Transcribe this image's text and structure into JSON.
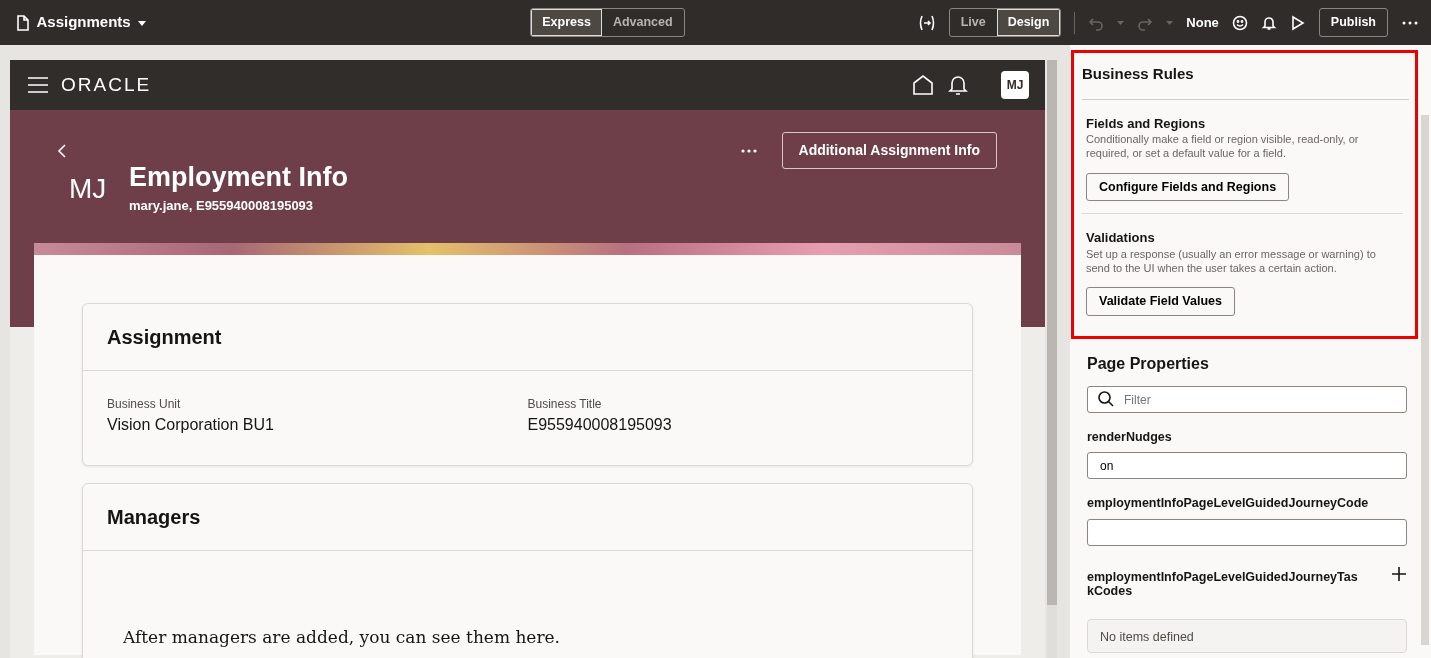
{
  "toolbar": {
    "page_title": "Assignments",
    "mode_tabs": [
      {
        "label": "Express",
        "selected": true
      },
      {
        "label": "Advanced",
        "selected": false
      }
    ],
    "view_tabs": [
      {
        "label": "Live",
        "selected": false
      },
      {
        "label": "Design",
        "selected": true
      }
    ],
    "undo_disabled": true,
    "redo_disabled": true,
    "audience": "None",
    "publish_button": "Publish"
  },
  "preview": {
    "app_header": {
      "brand": "ORACLE",
      "avatar": "MJ"
    },
    "page_header": {
      "action_button": "Additional Assignment Info",
      "initials": "MJ",
      "title": "Employment Info",
      "subtitle": "mary.jane, E955940008195093"
    },
    "cards": [
      {
        "title": "Assignment",
        "fields": [
          {
            "label": "Business Unit",
            "value": "Vision Corporation BU1"
          },
          {
            "label": "Business Title",
            "value": "E955940008195093"
          }
        ]
      },
      {
        "title": "Managers",
        "empty_message": "After managers are added, you can see them here."
      }
    ]
  },
  "side_panel": {
    "business_rules": {
      "title": "Business Rules",
      "highlighted": true,
      "sections": [
        {
          "title": "Fields and Regions",
          "description": "Conditionally make a field or region visible, read-only, or required, or set a default value for a field.",
          "button": "Configure Fields and Regions"
        },
        {
          "title": "Validations",
          "description": "Set up a response (usually an error message or warning) to send to the UI when the user takes a certain action.",
          "button": "Validate Field Values"
        }
      ]
    },
    "page_properties": {
      "title": "Page Properties",
      "filter": {
        "placeholder": "Filter"
      },
      "properties": [
        {
          "kind": "text",
          "label": "renderNudges",
          "value": "on"
        },
        {
          "kind": "text",
          "label": "employmentInfoPageLevelGuidedJourneyCode"
        },
        {
          "kind": "list",
          "label": "employmentInfoPageLevelGuidedJourneyTas\nkCodes",
          "empty_text": "No items defined"
        }
      ]
    }
  }
}
